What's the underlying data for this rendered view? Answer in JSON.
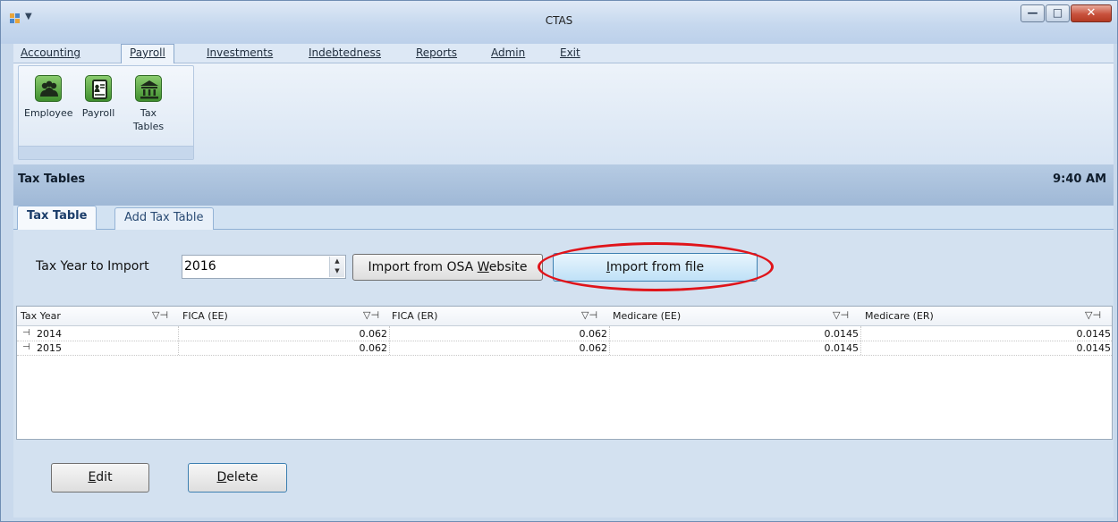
{
  "window": {
    "title": "CTAS"
  },
  "menu": {
    "items": [
      {
        "label": "Accounting"
      },
      {
        "label": "Payroll",
        "active": true
      },
      {
        "label": "Investments"
      },
      {
        "label": "Indebtedness"
      },
      {
        "label": "Reports"
      },
      {
        "label": "Admin"
      },
      {
        "label": "Exit"
      }
    ]
  },
  "ribbon": {
    "buttons": [
      {
        "label": "Employee",
        "icon": "employees-icon"
      },
      {
        "label": "Payroll",
        "icon": "payroll-document-icon"
      },
      {
        "label": "Tax\nTables",
        "line1": "Tax",
        "line2": "Tables",
        "icon": "bank-building-icon"
      }
    ]
  },
  "section": {
    "title": "Tax Tables",
    "clock": "9:40 AM"
  },
  "tabs": [
    {
      "label": "Tax Table",
      "active": true
    },
    {
      "label": "Add Tax Table"
    }
  ],
  "import": {
    "label": "Tax Year to Import",
    "year_value": "2016",
    "osa_button": {
      "pre": "Import from OSA ",
      "mnemonic": "W",
      "post": "ebsite"
    },
    "file_button": {
      "pre": "",
      "mnemonic": "I",
      "post": "mport from file"
    }
  },
  "grid": {
    "columns": [
      "Tax Year",
      "FICA (EE)",
      "FICA (ER)",
      "Medicare (EE)",
      "Medicare (ER)"
    ],
    "rows": [
      {
        "tax_year": "2014",
        "fica_ee": "0.062",
        "fica_er": "0.062",
        "medicare_ee": "0.0145",
        "medicare_er": "0.0145"
      },
      {
        "tax_year": "2015",
        "fica_ee": "0.062",
        "fica_er": "0.062",
        "medicare_ee": "0.0145",
        "medicare_er": "0.0145"
      }
    ]
  },
  "actions": {
    "edit": {
      "mnemonic": "E",
      "post": "dit"
    },
    "delete": {
      "mnemonic": "D",
      "post": "elete"
    }
  },
  "colors": {
    "highlight": "#e0141a",
    "ribbon_icon": "#3f8f2e"
  }
}
